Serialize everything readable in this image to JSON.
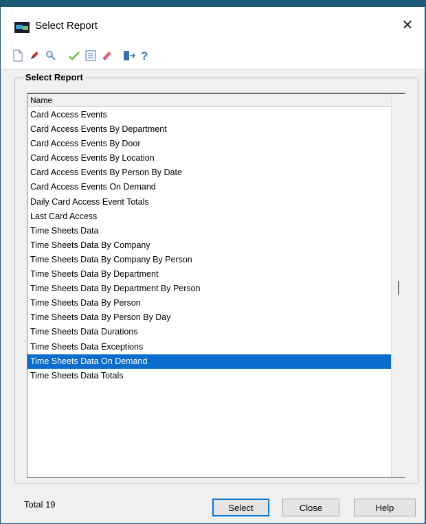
{
  "window": {
    "title": "Select Report",
    "close_glyph": "✕"
  },
  "toolbar": {
    "icons": [
      "new-document-icon",
      "edit-pencil-icon",
      "search-magnifier-icon",
      "checkmark-icon",
      "list-view-icon",
      "eraser-icon",
      "exit-door-icon",
      "help-question-icon"
    ]
  },
  "group": {
    "title": "Select Report"
  },
  "list": {
    "column_header": "Name",
    "selected_index": 17,
    "items": [
      "Card Access Events",
      "Card Access Events By Department",
      "Card Access Events By Door",
      "Card Access Events By Location",
      "Card Access Events By Person By Date",
      "Card Access Events On Demand",
      "Daily Card Access Event Totals",
      "Last Card Access",
      "Time Sheets Data",
      "Time Sheets Data By Company",
      "Time Sheets Data By Company By Person",
      "Time Sheets Data By Department",
      "Time Sheets Data By Department By Person",
      "Time Sheets Data By Person",
      "Time Sheets Data By Person By Day",
      "Time Sheets Data Durations",
      "Time Sheets Data Exceptions",
      "Time Sheets Data On Demand",
      "Time Sheets Data Totals"
    ]
  },
  "status": {
    "total": "Total 19"
  },
  "buttons": {
    "select": "Select",
    "close": "Close",
    "help": "Help"
  },
  "colors": {
    "selection": "#0a6ccc",
    "accent": "#0078d7"
  }
}
